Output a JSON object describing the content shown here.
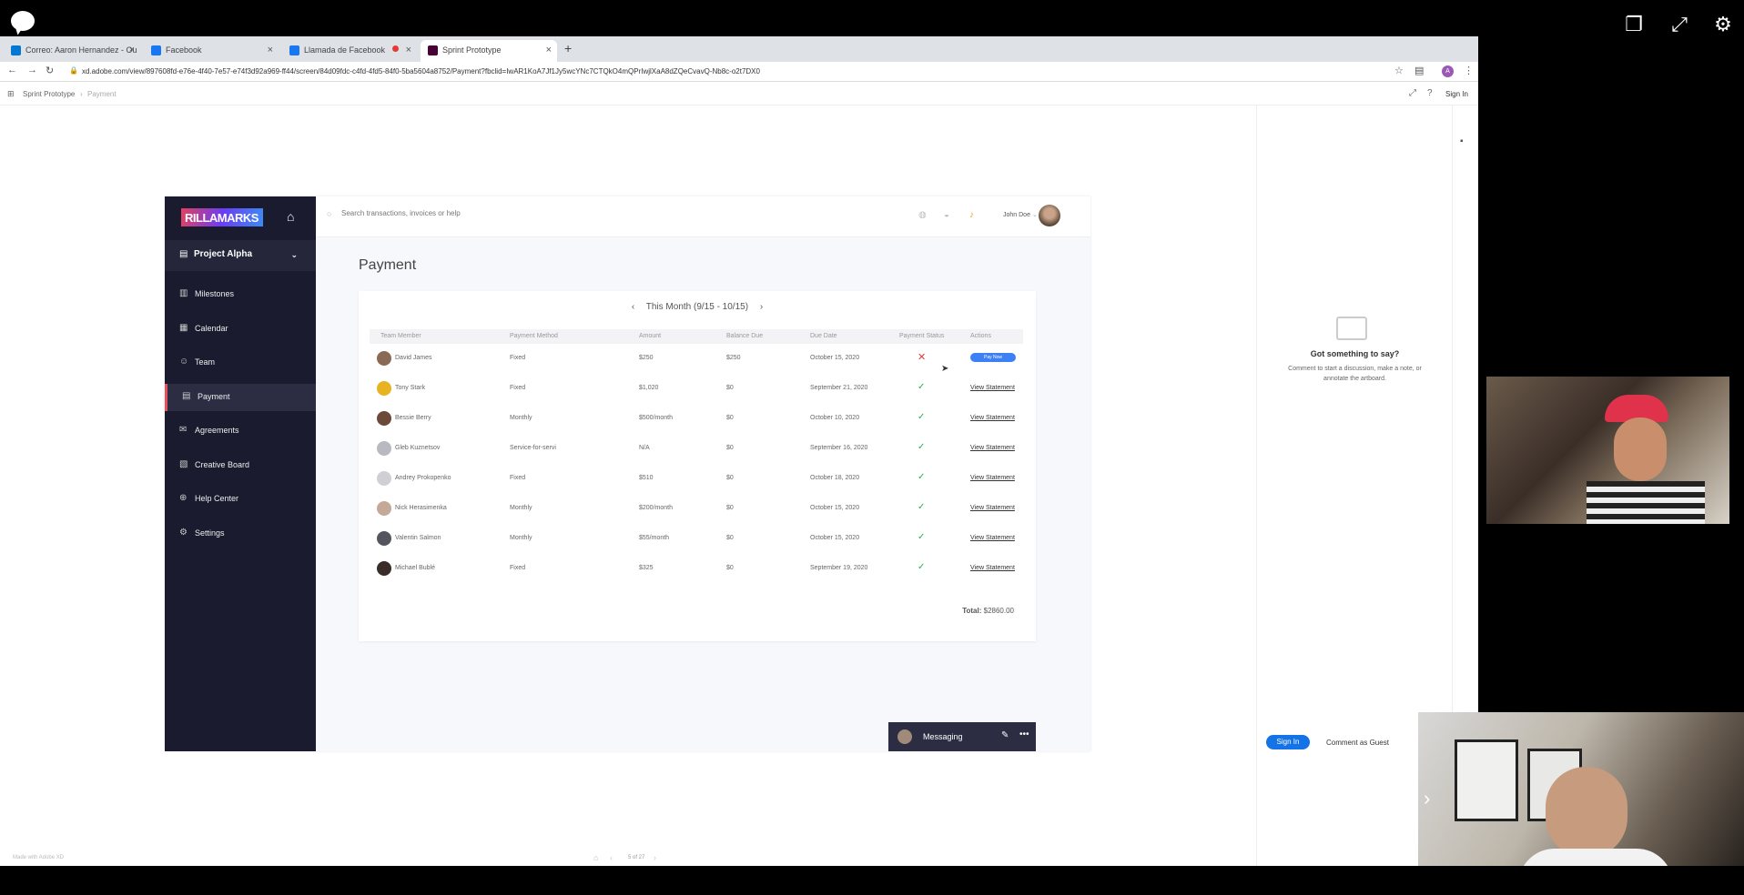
{
  "tabs": [
    {
      "label": "Correo: Aaron Hernandez - Ou",
      "color": "#0078d4"
    },
    {
      "label": "Facebook",
      "color": "#1877f2"
    },
    {
      "label": "Llamada de Facebook",
      "color": "#1877f2"
    },
    {
      "label": "Sprint Prototype",
      "color": "#470137"
    }
  ],
  "address": {
    "url": "xd.adobe.com/view/897608fd-e76e-4f40-7e57-e74f3d92a969-ff44/screen/84d09fdc-c4fd-4fd5-84f0-5ba5604a8752/Payment?fbclid=IwAR1KoA7Jf1Jy5wcYNc7CTQkO4mQPrIwjlXaA8dZQeCvavQ-Nb8c-o2t7DX0"
  },
  "xd": {
    "breadcrumb_root": "Sprint Prototype",
    "breadcrumb_page": "Payment",
    "signin": "Sign In",
    "made_with": "Made with Adobe XD",
    "pager": "5 of 27"
  },
  "app": {
    "logo": "RILLAMARKS",
    "project": "Project Alpha",
    "nav": [
      {
        "label": "Milestones",
        "icon": "bar-chart-icon"
      },
      {
        "label": "Calendar",
        "icon": "calendar-icon"
      },
      {
        "label": "Team",
        "icon": "team-icon"
      },
      {
        "label": "Payment",
        "icon": "payment-icon"
      },
      {
        "label": "Agreements",
        "icon": "agreements-icon"
      },
      {
        "label": "Creative Board",
        "icon": "creative-board-icon"
      },
      {
        "label": "Help Center",
        "icon": "help-icon"
      },
      {
        "label": "Settings",
        "icon": "settings-icon"
      }
    ],
    "search_placeholder": "Search transactions, invoices or help",
    "user_name": "John Doe",
    "page_title": "Payment",
    "period": "This Month (9/15 - 10/15)",
    "columns": [
      "Team Member",
      "Payment Method",
      "Amount",
      "Balance Due",
      "Due Date",
      "Payment Status",
      "Actions"
    ],
    "rows": [
      {
        "name": "David James",
        "method": "Fixed",
        "amount": "$250",
        "balance": "$250",
        "due": "October 15, 2020",
        "paid": false,
        "action": "Pay Now",
        "avatar_color": "#8a6a55"
      },
      {
        "name": "Tony Stark",
        "method": "Fixed",
        "amount": "$1,020",
        "balance": "$0",
        "due": "September 21, 2020",
        "paid": true,
        "action": "View Statement",
        "avatar_color": "#e8b320"
      },
      {
        "name": "Bessie Berry",
        "method": "Monthly",
        "amount": "$500/month",
        "balance": "$0",
        "due": "October 10, 2020",
        "paid": true,
        "action": "View Statement",
        "avatar_color": "#6b4a3a"
      },
      {
        "name": "Gleb Kuznetsov",
        "method": "Service-for-servi",
        "amount": "N/A",
        "balance": "$0",
        "due": "September 16, 2020",
        "paid": true,
        "action": "View Statement",
        "avatar_color": "#b9b9c2"
      },
      {
        "name": "Andrey Prokopenko",
        "method": "Fixed",
        "amount": "$510",
        "balance": "$0",
        "due": "October 18, 2020",
        "paid": true,
        "action": "View Statement",
        "avatar_color": "#d0cfd6"
      },
      {
        "name": "Nick Herasimenka",
        "method": "Monthly",
        "amount": "$200/month",
        "balance": "$0",
        "due": "October 15, 2020",
        "paid": true,
        "action": "View Statement",
        "avatar_color": "#c4a999"
      },
      {
        "name": "Valentin Salmon",
        "method": "Monthly",
        "amount": "$55/month",
        "balance": "$0",
        "due": "October 15, 2020",
        "paid": true,
        "action": "View Statement",
        "avatar_color": "#555560"
      },
      {
        "name": "Michael Bublé",
        "method": "Fixed",
        "amount": "$325",
        "balance": "$0",
        "due": "September 19, 2020",
        "paid": true,
        "action": "View Statement",
        "avatar_color": "#3a2c28"
      }
    ],
    "total_label": "Total:",
    "total_value": "$2860.00",
    "messaging": "Messaging"
  },
  "comments": {
    "title": "Got something to say?",
    "body": "Comment to start a discussion, make a note, or annotate the artboard.",
    "signin": "Sign In",
    "guest": "Comment as Guest"
  }
}
